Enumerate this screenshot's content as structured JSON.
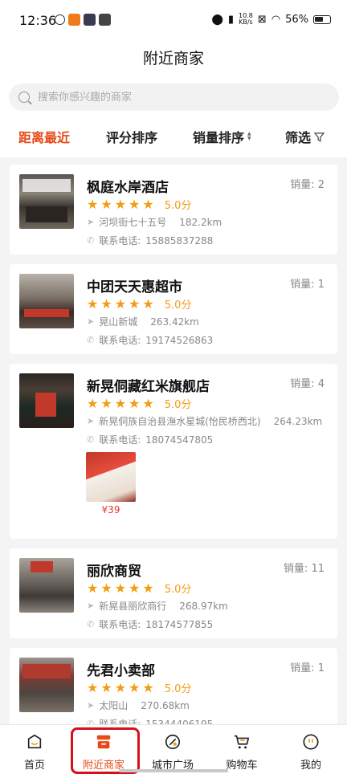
{
  "status_bar": {
    "time": "12:36",
    "net_rate": "10.8",
    "net_unit": "KB/s",
    "battery": "56%"
  },
  "page_title": "附近商家",
  "search": {
    "placeholder": "搜索你感兴趣的商家"
  },
  "sort_tabs": [
    {
      "label": "距离最近",
      "active": true
    },
    {
      "label": "评分排序"
    },
    {
      "label": "销量排序"
    },
    {
      "label": "筛选"
    }
  ],
  "sales_prefix": "销量:",
  "phone_prefix": "联系电话:",
  "shops": [
    {
      "name": "枫庭水岸酒店",
      "sales": "2",
      "rating": "5.0分",
      "stars": 5,
      "address": "河坝街七十五号",
      "distance": "182.2km",
      "phone": "15885837288"
    },
    {
      "name": "中团天天惠超市",
      "sales": "1",
      "rating": "5.0分",
      "stars": 5,
      "address": "晃山新城",
      "distance": "263.42km",
      "phone": "19174526863"
    },
    {
      "name": "新晃侗藏红米旗舰店",
      "sales": "4",
      "rating": "5.0分",
      "stars": 5,
      "address": "新晃侗族自治县潕水星城(怡民桥西北)",
      "distance": "264.23km",
      "phone": "18074547805",
      "product_price": "¥39"
    },
    {
      "name": "丽欣商贸",
      "sales": "11",
      "rating": "5.0分",
      "stars": 5,
      "address": "新晃县丽欣商行",
      "distance": "268.97km",
      "phone": "18174577855"
    },
    {
      "name": "先君小卖部",
      "sales": "1",
      "rating": "5.0分",
      "stars": 5,
      "address": "太阳山",
      "distance": "270.68km",
      "phone": "15344406195"
    }
  ],
  "tabbar": [
    {
      "label": "首页",
      "icon": "home-icon"
    },
    {
      "label": "附近商家",
      "icon": "shop-icon",
      "active": true
    },
    {
      "label": "城市广场",
      "icon": "city-square-icon"
    },
    {
      "label": "购物车",
      "icon": "cart-icon"
    },
    {
      "label": "我的",
      "icon": "profile-icon"
    }
  ],
  "colors": {
    "accent": "#e64a19",
    "star": "#f39c12",
    "price": "#e53935",
    "highlight": "#d4101c"
  }
}
